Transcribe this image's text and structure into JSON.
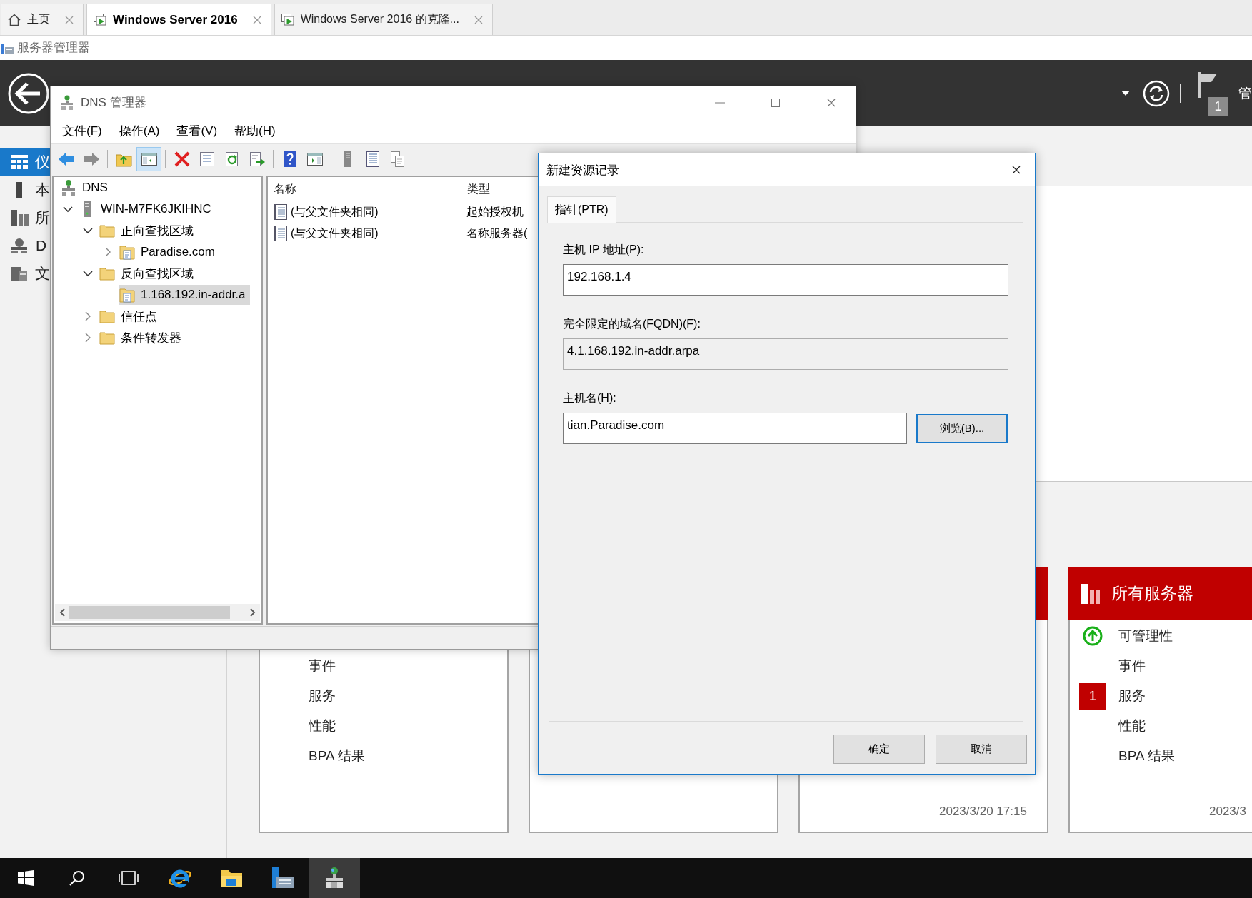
{
  "browser": {
    "tabs": [
      {
        "label": "主页",
        "kind": "home",
        "selected": false
      },
      {
        "label": "Windows Server 2016",
        "kind": "vm",
        "selected": true
      },
      {
        "label": "Windows Server 2016 的克隆...",
        "kind": "vm",
        "selected": false
      }
    ],
    "page_title": "服务器管理器"
  },
  "server_manager": {
    "header": {
      "notifications": "1",
      "manage_menu": "管"
    },
    "nav": [
      {
        "label": "仪",
        "selected": true
      },
      {
        "label": "本",
        "selected": false
      },
      {
        "label": "所",
        "selected": false
      },
      {
        "label": "D",
        "selected": false
      },
      {
        "label": "文",
        "selected": false
      }
    ],
    "tiles": [
      {
        "kind": "tile",
        "items": [
          {
            "label": "事件"
          },
          {
            "label": "服务"
          },
          {
            "label": "性能"
          },
          {
            "label": "BPA 结果"
          }
        ]
      },
      {
        "kind": "tile"
      },
      {
        "kind": "tile",
        "alert": true,
        "timestamp": "2023/3/20 17:15"
      },
      {
        "kind": "tile",
        "alert": true,
        "title": "所有服务器",
        "items": [
          {
            "label": "可管理性",
            "healthy": true
          },
          {
            "label": "事件"
          },
          {
            "label": "服务",
            "count": "1"
          },
          {
            "label": "性能"
          },
          {
            "label": "BPA 结果"
          }
        ],
        "timestamp": "2023/3"
      }
    ]
  },
  "dns_manager": {
    "title": "DNS 管理器",
    "menu": [
      "文件(F)",
      "操作(A)",
      "查看(V)",
      "帮助(H)"
    ],
    "toolbar": [
      [
        {
          "pressed": false
        },
        {
          "pressed": false
        }
      ],
      [
        {
          "pressed": false
        },
        {
          "pressed": true
        }
      ],
      [
        {
          "pressed": false
        },
        {
          "pressed": false
        },
        {
          "pressed": false
        },
        {
          "pressed": false
        }
      ],
      [
        {
          "pressed": false
        },
        {
          "pressed": false
        }
      ],
      [
        {
          "pressed": false
        },
        {
          "pressed": false
        },
        {
          "pressed": false
        }
      ]
    ],
    "tree": [
      {
        "label": "DNS",
        "kind": "root",
        "selected": false,
        "children": [
          {
            "label": "WIN-M7FK6JKIHNC",
            "kind": "server",
            "expanded": true,
            "selected": false,
            "children": [
              {
                "label": "正向查找区域",
                "kind": "folder",
                "expanded": true,
                "selected": false,
                "children": [
                  {
                    "label": "Paradise.com",
                    "kind": "zone",
                    "expanded": false,
                    "selected": false
                  }
                ]
              },
              {
                "label": "反向查找区域",
                "kind": "folder",
                "expanded": true,
                "selected": false,
                "children": [
                  {
                    "label": "1.168.192.in-addr.a",
                    "kind": "zone",
                    "selected": true
                  }
                ]
              },
              {
                "label": "信任点",
                "kind": "folder",
                "expanded": false,
                "selected": false
              },
              {
                "label": "条件转发器",
                "kind": "folder",
                "expanded": false,
                "selected": false
              }
            ]
          }
        ]
      }
    ],
    "list": {
      "columns": [
        "名称",
        "类型"
      ],
      "rows": [
        {
          "name": "(与父文件夹相同)",
          "type": "起始授权机",
          "selected": false
        },
        {
          "name": "(与父文件夹相同)",
          "type": "名称服务器(",
          "selected": false
        }
      ]
    }
  },
  "dialog": {
    "title": "新建资源记录",
    "tabs": [
      {
        "label": "指针(PTR)",
        "selected": true
      }
    ],
    "fields": [
      {
        "label": "主机 IP 地址(P):",
        "value": "192.168.1.4",
        "readonly": false
      },
      {
        "label": "完全限定的域名(FQDN)(F):",
        "value": "4.1.168.192.in-addr.arpa",
        "readonly": true
      },
      {
        "label": "主机名(H):",
        "value": "tian.Paradise.com",
        "readonly": false,
        "button": {
          "label": "浏览(B)...",
          "focused": true
        }
      }
    ],
    "buttons": [
      "确定",
      "取消"
    ]
  },
  "taskbar": {
    "apps": [
      {
        "kind": "browser",
        "active": false
      },
      {
        "kind": "files",
        "active": false
      },
      {
        "kind": "server-manager",
        "active": false
      },
      {
        "kind": "dns",
        "active": true
      }
    ]
  }
}
